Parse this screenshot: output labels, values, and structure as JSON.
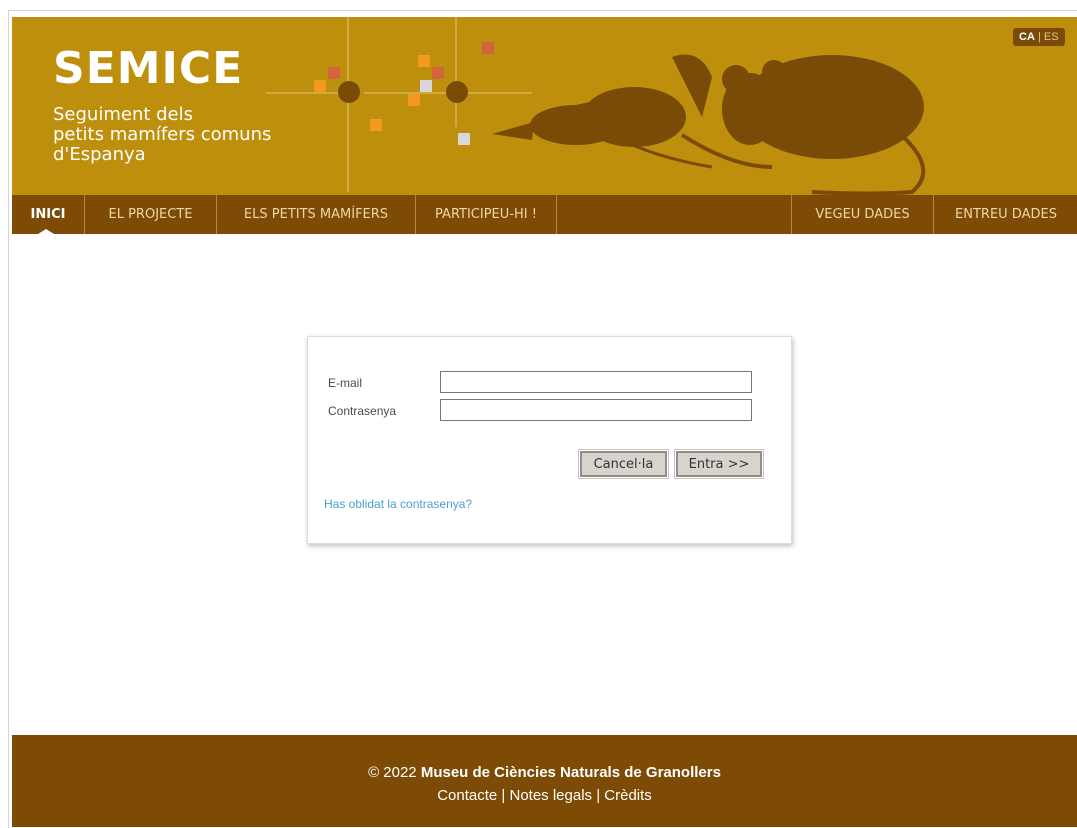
{
  "header": {
    "logo": "SEMICE",
    "subtitle_lines": [
      "Seguiment dels",
      "petits mamífers comuns",
      "d'Espanya"
    ],
    "lang": {
      "active": "CA",
      "separator": "|",
      "other": "ES"
    }
  },
  "nav": {
    "items": [
      {
        "label": "INICI",
        "active": true
      },
      {
        "label": "EL PROJECTE"
      },
      {
        "label": "ELS PETITS MAMÍFERS"
      },
      {
        "label": "PARTICIPEU-HI !"
      },
      {
        "label": "VEGEU DADES"
      },
      {
        "label": "ENTREU DADES"
      }
    ]
  },
  "login": {
    "email_label": "E-mail",
    "password_label": "Contrasenya",
    "email_value": "",
    "password_value": "",
    "cancel_label": "Cancel·la",
    "submit_label": "Entra >>",
    "forgot_link": "Has oblidat la contrasenya?"
  },
  "footer": {
    "copyright": "© 2022",
    "org": "Museu de Ciències Naturals de Granollers",
    "links": [
      "Contacte",
      "Notes legals",
      "Crèdits"
    ],
    "separator": "|"
  },
  "colors": {
    "banner": "#bd8f0c",
    "nav": "#7d4b05",
    "footer": "#7d4b05",
    "link": "#4a9fd2",
    "animal_silhouette": "#7a4b07"
  },
  "icons": [
    "rodent-silhouette-illustration",
    "nav-active-marker"
  ]
}
